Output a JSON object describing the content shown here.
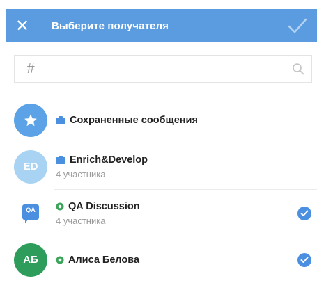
{
  "header": {
    "close_symbol": "✕",
    "title": "Выберите получателя",
    "background_color": "#5b9ce0"
  },
  "search": {
    "hash_symbol": "#",
    "placeholder": "",
    "value": ""
  },
  "chats": [
    {
      "title": "Сохраненные сообщения",
      "subtitle": "",
      "avatar_text": "",
      "avatar_icon": "star-icon",
      "type_icon": "channel-icon",
      "selected": false
    },
    {
      "title": "Enrich&Develop",
      "subtitle": "4 участника",
      "avatar_text": "ED",
      "type_icon": "channel-icon",
      "selected": false
    },
    {
      "title": "QA Discussion",
      "subtitle": "4 участника",
      "avatar_text": "QA",
      "type_icon": "group-icon",
      "selected": true
    },
    {
      "title": "Алиса Белова",
      "subtitle": "",
      "avatar_text": "АБ",
      "type_icon": "group-icon",
      "selected": true
    }
  ]
}
